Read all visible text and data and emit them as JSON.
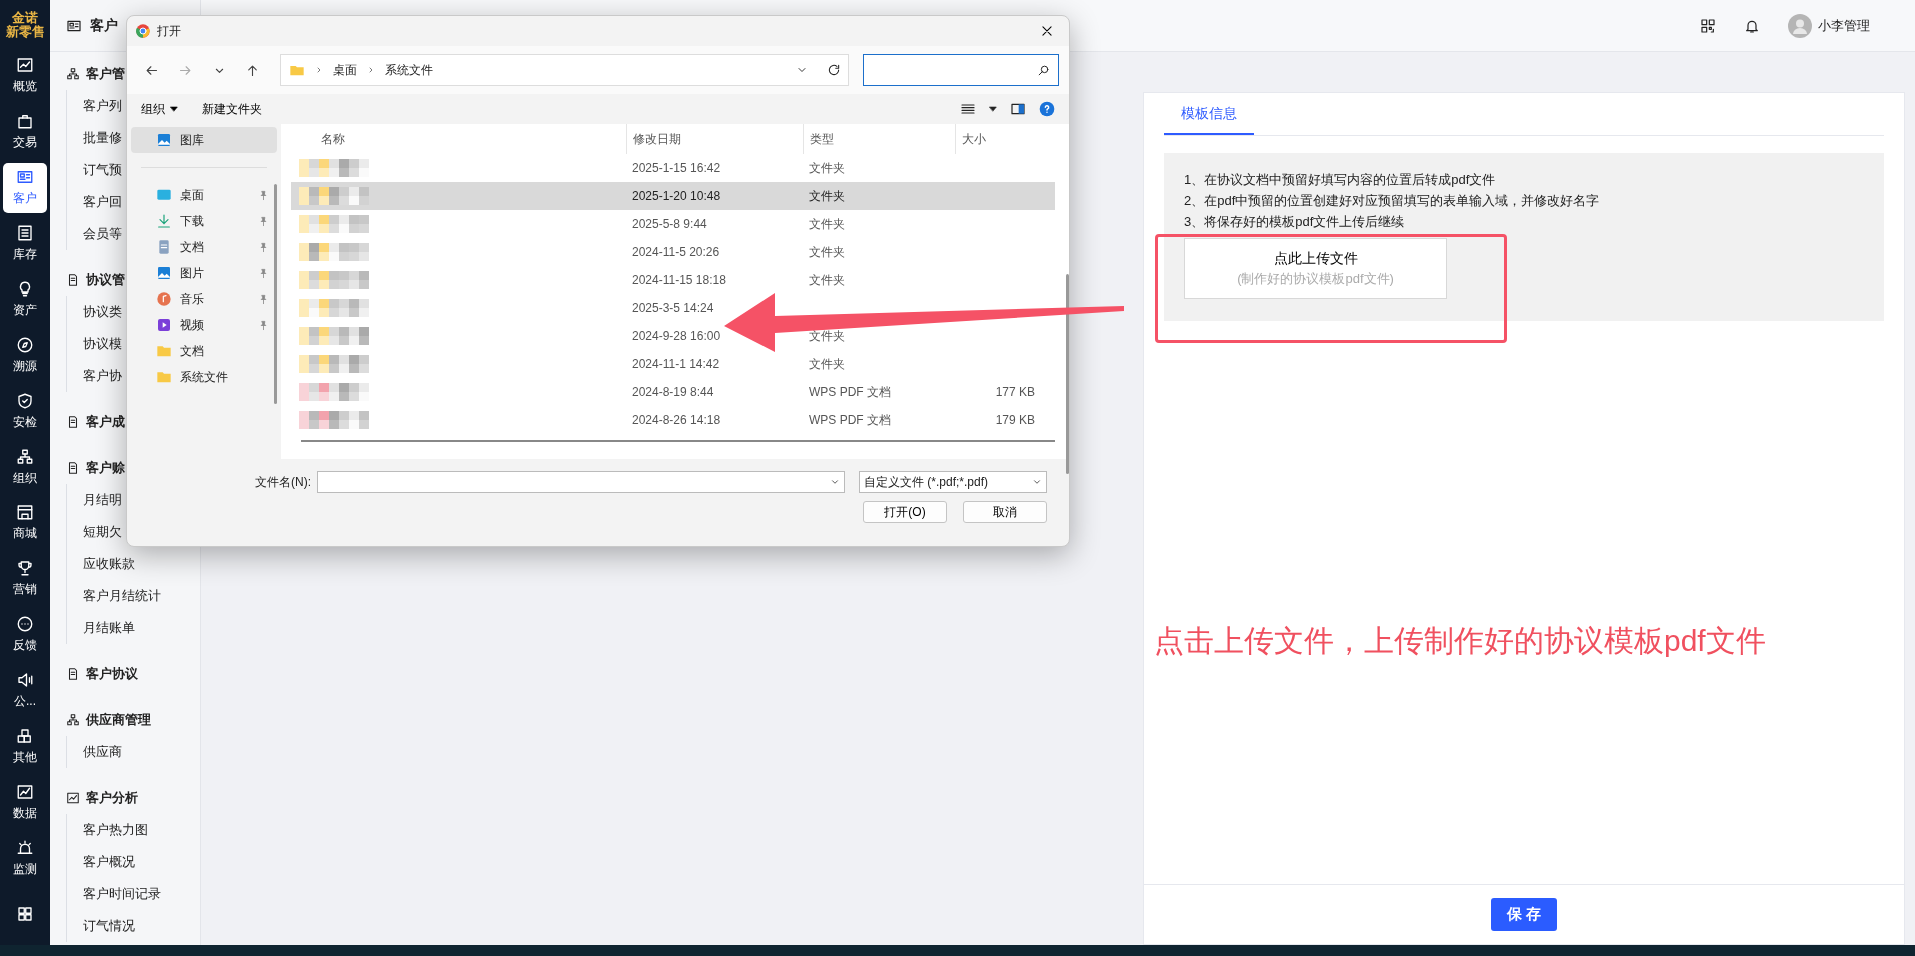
{
  "rail": {
    "logo_top": "金诺",
    "logo_bottom": "新零售",
    "items": [
      {
        "label": "概览",
        "selected": false
      },
      {
        "label": "交易",
        "selected": false
      },
      {
        "label": "客户",
        "selected": true
      },
      {
        "label": "库存",
        "selected": false
      },
      {
        "label": "资产",
        "selected": false
      },
      {
        "label": "溯源",
        "selected": false
      },
      {
        "label": "安检",
        "selected": false
      },
      {
        "label": "组织",
        "selected": false
      },
      {
        "label": "商城",
        "selected": false
      },
      {
        "label": "营销",
        "selected": false
      },
      {
        "label": "反馈",
        "selected": false
      },
      {
        "label": "公...",
        "selected": false
      },
      {
        "label": "其他",
        "selected": false
      },
      {
        "label": "数据",
        "selected": false
      },
      {
        "label": "监测",
        "selected": false
      }
    ]
  },
  "sidebar": {
    "title": "客户",
    "groups": [
      {
        "label": "客户管",
        "children": [
          "客户列",
          "批量修",
          "订气预",
          "客户回",
          "会员等"
        ]
      },
      {
        "label": "协议管",
        "children": [
          "协议类",
          "协议模",
          "客户协"
        ]
      },
      {
        "label": "客户成"
      },
      {
        "label": "客户赊",
        "children": [
          "月结明",
          "短期欠",
          "应收账款",
          "客户月结统计",
          "月结账单"
        ]
      },
      {
        "label": "客户协议"
      },
      {
        "label": "供应商管理",
        "children": [
          "供应商"
        ]
      },
      {
        "label": "客户分析",
        "children": [
          "客户热力图",
          "客户概况",
          "客户时间记录",
          "订气情况"
        ]
      }
    ]
  },
  "header": {
    "user": "小李管理"
  },
  "panel": {
    "tabs": [
      {
        "label": "模板信息",
        "selected": true
      }
    ],
    "steps": [
      "1、在协议文档中预留好填写内容的位置后转成pdf文件",
      "2、在pdf中预留的位置创建好对应预留填写的表单输入域，并修改好名字",
      "3、将保存好的模板pdf文件上传后继续"
    ],
    "upload": {
      "title": "点此上传文件",
      "hint": "(制作好的协议模板pdf文件)"
    },
    "save": "保 存"
  },
  "dialog": {
    "title": "打开",
    "path": [
      "桌面",
      "系统文件"
    ],
    "toolbar": [
      "组织",
      "新建文件夹"
    ],
    "nav": [
      {
        "label": "图库",
        "selected": true,
        "pinned": false
      },
      {
        "label": "桌面",
        "selected": false,
        "pinned": true
      },
      {
        "label": "下载",
        "selected": false,
        "pinned": true
      },
      {
        "label": "文档",
        "selected": false,
        "pinned": true
      },
      {
        "label": "图片",
        "selected": false,
        "pinned": true
      },
      {
        "label": "音乐",
        "selected": false,
        "pinned": true
      },
      {
        "label": "视频",
        "selected": false,
        "pinned": true
      },
      {
        "label": "文档",
        "selected": false,
        "pinned": false
      },
      {
        "label": "系统文件",
        "selected": false,
        "pinned": false
      }
    ],
    "columns": [
      "名称",
      "修改日期",
      "类型",
      "大小"
    ],
    "files": [
      {
        "kind": "folder",
        "modified": "2025-1-15 16:42",
        "type": "文件夹",
        "selected": false
      },
      {
        "kind": "folder",
        "modified": "2025-1-20 10:48",
        "type": "文件夹",
        "selected": true
      },
      {
        "kind": "folder",
        "modified": "2025-5-8 9:44",
        "type": "文件夹",
        "selected": false
      },
      {
        "kind": "folder",
        "modified": "2024-11-5 20:26",
        "type": "文件夹",
        "selected": false
      },
      {
        "kind": "folder",
        "modified": "2024-11-15 18:18",
        "type": "文件夹",
        "selected": false
      },
      {
        "kind": "folder",
        "modified": "2025-3-5 14:24",
        "selected": false
      },
      {
        "kind": "folder",
        "modified": "2024-9-28 16:00",
        "type": "文件夹",
        "selected": false
      },
      {
        "kind": "folder",
        "modified": "2024-11-1 14:42",
        "type": "文件夹",
        "selected": false
      },
      {
        "kind": "pdf",
        "modified": "2024-8-19 8:44",
        "type": "WPS PDF 文档",
        "size": "177 KB",
        "selected": false
      },
      {
        "kind": "pdf",
        "modified": "2024-8-26 14:18",
        "type": "WPS PDF 文档",
        "size": "179 KB",
        "selected": false
      }
    ],
    "filename_label": "文件名(N):",
    "filetype": "自定义文件 (*.pdf;*.pdf)",
    "buttons": [
      "打开(O)",
      "取消"
    ]
  },
  "annotation": {
    "note": "点击上传文件，上传制作好的协议模板pdf文件"
  }
}
